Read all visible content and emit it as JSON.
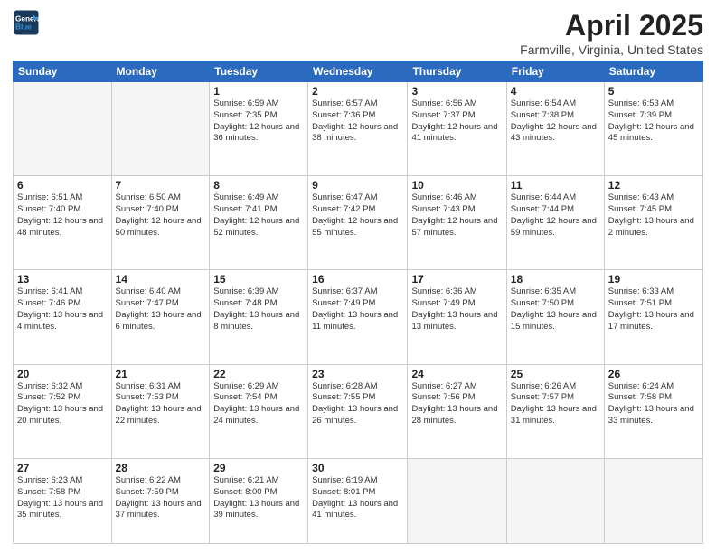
{
  "header": {
    "logo_line1": "General",
    "logo_line2": "Blue",
    "month_title": "April 2025",
    "location": "Farmville, Virginia, United States"
  },
  "days_of_week": [
    "Sunday",
    "Monday",
    "Tuesday",
    "Wednesday",
    "Thursday",
    "Friday",
    "Saturday"
  ],
  "weeks": [
    [
      {
        "day": "",
        "info": ""
      },
      {
        "day": "",
        "info": ""
      },
      {
        "day": "1",
        "info": "Sunrise: 6:59 AM\nSunset: 7:35 PM\nDaylight: 12 hours and 36 minutes."
      },
      {
        "day": "2",
        "info": "Sunrise: 6:57 AM\nSunset: 7:36 PM\nDaylight: 12 hours and 38 minutes."
      },
      {
        "day": "3",
        "info": "Sunrise: 6:56 AM\nSunset: 7:37 PM\nDaylight: 12 hours and 41 minutes."
      },
      {
        "day": "4",
        "info": "Sunrise: 6:54 AM\nSunset: 7:38 PM\nDaylight: 12 hours and 43 minutes."
      },
      {
        "day": "5",
        "info": "Sunrise: 6:53 AM\nSunset: 7:39 PM\nDaylight: 12 hours and 45 minutes."
      }
    ],
    [
      {
        "day": "6",
        "info": "Sunrise: 6:51 AM\nSunset: 7:40 PM\nDaylight: 12 hours and 48 minutes."
      },
      {
        "day": "7",
        "info": "Sunrise: 6:50 AM\nSunset: 7:40 PM\nDaylight: 12 hours and 50 minutes."
      },
      {
        "day": "8",
        "info": "Sunrise: 6:49 AM\nSunset: 7:41 PM\nDaylight: 12 hours and 52 minutes."
      },
      {
        "day": "9",
        "info": "Sunrise: 6:47 AM\nSunset: 7:42 PM\nDaylight: 12 hours and 55 minutes."
      },
      {
        "day": "10",
        "info": "Sunrise: 6:46 AM\nSunset: 7:43 PM\nDaylight: 12 hours and 57 minutes."
      },
      {
        "day": "11",
        "info": "Sunrise: 6:44 AM\nSunset: 7:44 PM\nDaylight: 12 hours and 59 minutes."
      },
      {
        "day": "12",
        "info": "Sunrise: 6:43 AM\nSunset: 7:45 PM\nDaylight: 13 hours and 2 minutes."
      }
    ],
    [
      {
        "day": "13",
        "info": "Sunrise: 6:41 AM\nSunset: 7:46 PM\nDaylight: 13 hours and 4 minutes."
      },
      {
        "day": "14",
        "info": "Sunrise: 6:40 AM\nSunset: 7:47 PM\nDaylight: 13 hours and 6 minutes."
      },
      {
        "day": "15",
        "info": "Sunrise: 6:39 AM\nSunset: 7:48 PM\nDaylight: 13 hours and 8 minutes."
      },
      {
        "day": "16",
        "info": "Sunrise: 6:37 AM\nSunset: 7:49 PM\nDaylight: 13 hours and 11 minutes."
      },
      {
        "day": "17",
        "info": "Sunrise: 6:36 AM\nSunset: 7:49 PM\nDaylight: 13 hours and 13 minutes."
      },
      {
        "day": "18",
        "info": "Sunrise: 6:35 AM\nSunset: 7:50 PM\nDaylight: 13 hours and 15 minutes."
      },
      {
        "day": "19",
        "info": "Sunrise: 6:33 AM\nSunset: 7:51 PM\nDaylight: 13 hours and 17 minutes."
      }
    ],
    [
      {
        "day": "20",
        "info": "Sunrise: 6:32 AM\nSunset: 7:52 PM\nDaylight: 13 hours and 20 minutes."
      },
      {
        "day": "21",
        "info": "Sunrise: 6:31 AM\nSunset: 7:53 PM\nDaylight: 13 hours and 22 minutes."
      },
      {
        "day": "22",
        "info": "Sunrise: 6:29 AM\nSunset: 7:54 PM\nDaylight: 13 hours and 24 minutes."
      },
      {
        "day": "23",
        "info": "Sunrise: 6:28 AM\nSunset: 7:55 PM\nDaylight: 13 hours and 26 minutes."
      },
      {
        "day": "24",
        "info": "Sunrise: 6:27 AM\nSunset: 7:56 PM\nDaylight: 13 hours and 28 minutes."
      },
      {
        "day": "25",
        "info": "Sunrise: 6:26 AM\nSunset: 7:57 PM\nDaylight: 13 hours and 31 minutes."
      },
      {
        "day": "26",
        "info": "Sunrise: 6:24 AM\nSunset: 7:58 PM\nDaylight: 13 hours and 33 minutes."
      }
    ],
    [
      {
        "day": "27",
        "info": "Sunrise: 6:23 AM\nSunset: 7:58 PM\nDaylight: 13 hours and 35 minutes."
      },
      {
        "day": "28",
        "info": "Sunrise: 6:22 AM\nSunset: 7:59 PM\nDaylight: 13 hours and 37 minutes."
      },
      {
        "day": "29",
        "info": "Sunrise: 6:21 AM\nSunset: 8:00 PM\nDaylight: 13 hours and 39 minutes."
      },
      {
        "day": "30",
        "info": "Sunrise: 6:19 AM\nSunset: 8:01 PM\nDaylight: 13 hours and 41 minutes."
      },
      {
        "day": "",
        "info": ""
      },
      {
        "day": "",
        "info": ""
      },
      {
        "day": "",
        "info": ""
      }
    ]
  ]
}
